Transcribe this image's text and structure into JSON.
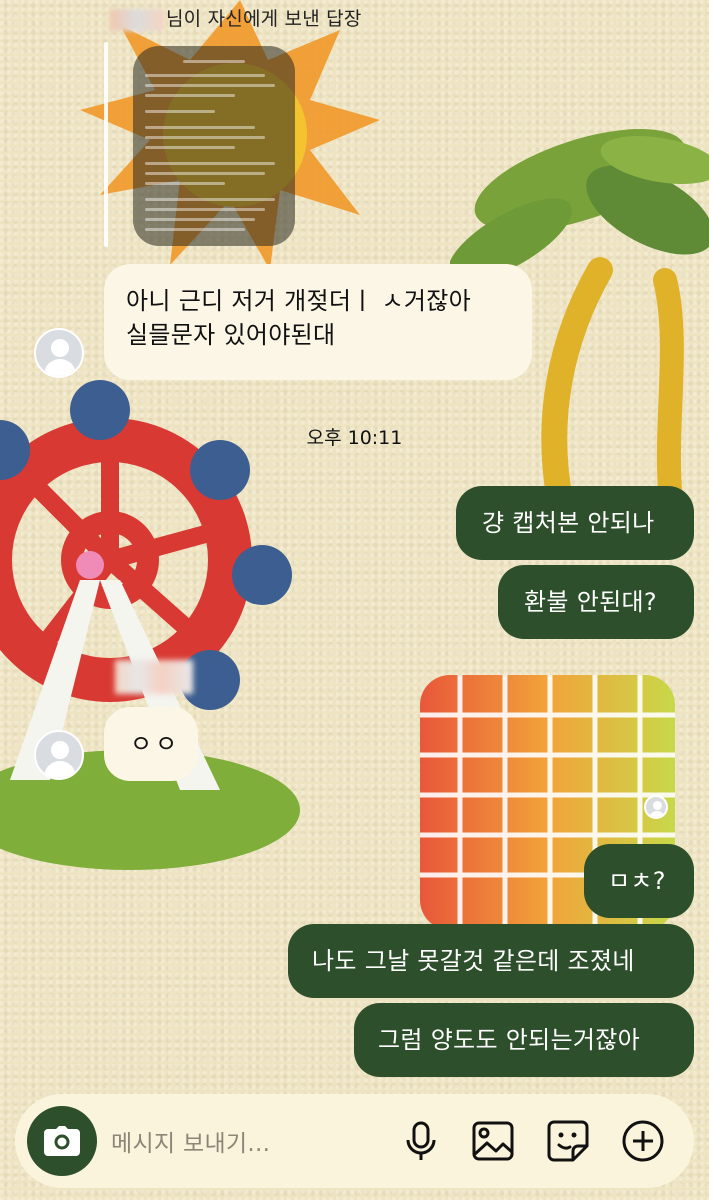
{
  "reply": {
    "header": "님이 자신에게 보낸 답장"
  },
  "messages": {
    "m1_line1": "아니 근디 저거 개젖더ㅣ ㅅ거잖아",
    "m1_line2": "실믈문자 있어야된대",
    "timestamp": "오후 10:11",
    "m2": "걍 캡처본 안되나",
    "m3": "환불 안된대?",
    "m4": "ㅇㅇ",
    "m5": "ㅁㅊ?",
    "m6": "나도 그날 못갈것 같은데 조졌네",
    "m7": "그럼 양도도 안되는거잖아"
  },
  "composer": {
    "placeholder": "메시지 보내기..."
  },
  "icons": {
    "camera": "camera-icon",
    "mic": "microphone-icon",
    "gallery": "image-icon",
    "sticker": "sticker-icon",
    "add": "plus-circle-icon"
  },
  "colors": {
    "outgoing": "#2d4f2b",
    "incoming": "#fbf6e6",
    "background": "#eee4c2"
  }
}
